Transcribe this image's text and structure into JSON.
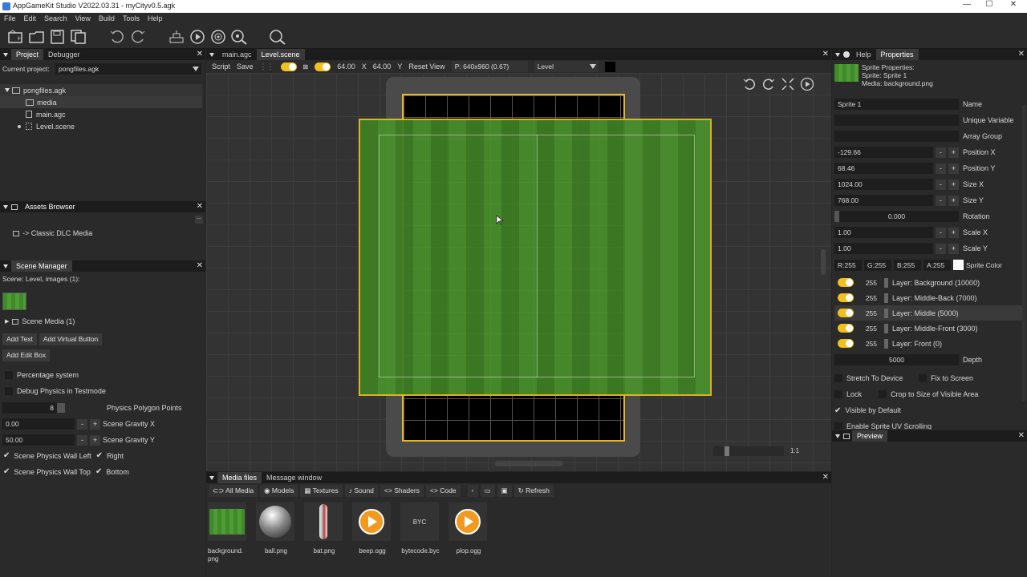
{
  "window": {
    "title": "AppGameKit Studio V2022.03.31 - myCityv0.5.agk",
    "min": "—",
    "max": "☐",
    "close": "✕"
  },
  "menu": [
    "File",
    "Edit",
    "Search",
    "View",
    "Build",
    "Tools",
    "Help"
  ],
  "project": {
    "tabs": [
      "Project",
      "Debugger"
    ],
    "current_label": "Current project:",
    "current_value": "pongfiles.agk",
    "tree": [
      {
        "name": "pongfiles.agk",
        "depth": 0,
        "icon": "folder-icon"
      },
      {
        "name": "media",
        "depth": 1,
        "icon": "folder-icon"
      },
      {
        "name": "main.agc",
        "depth": 1,
        "icon": "file-icon"
      },
      {
        "name": "Level.scene",
        "depth": 1,
        "icon": "scene-icon"
      }
    ]
  },
  "assets": {
    "title": "Assets Browser",
    "dots": "...",
    "item": "-> Classic DLC Media"
  },
  "scene_manager": {
    "title": "Scene Manager",
    "scene_label": "Scene: Level, images (1):",
    "scene_media": "Scene Media (1)",
    "add_text": "Add Text",
    "add_virtual_button": "Add Virtual Button",
    "add_edit_box": "Add Edit Box",
    "percentage": "Percentage system",
    "debug_physics": "Debug Physics in Testmode",
    "polygon_value": "8",
    "polygon_label": "Physics Polygon Points",
    "gravity_x_value": "0.00",
    "gravity_x_label": "Scene Gravity X",
    "gravity_y_value": "50.00",
    "gravity_y_label": "Scene Gravity Y",
    "minus": "-",
    "plus": "+",
    "wall_left": "Scene Physics Wall Left",
    "wall_right": "Right",
    "wall_top": "Scene Physics Wall Top",
    "wall_bottom": "Bottom"
  },
  "editor": {
    "tabs": [
      "main.agc",
      "Level.scene"
    ],
    "script": "Script",
    "save": "Save",
    "grid_x": "64.00",
    "x_label": "X",
    "grid_y": "64.00",
    "y_label": "Y",
    "reset_view": "Reset View",
    "resolution": "P: 640x960 (0.67)",
    "layer": "Level",
    "zoom": "1:1"
  },
  "media": {
    "tabs": [
      "Media files",
      "Message window"
    ],
    "filters": [
      "All Media",
      "Models",
      "Textures",
      "Sound",
      "Shaders",
      "Code"
    ],
    "refresh": "Refresh",
    "files": [
      {
        "name": "background.\npng",
        "kind": "grass"
      },
      {
        "name": "ball.png",
        "kind": "ball"
      },
      {
        "name": "bat.png",
        "kind": "bat"
      },
      {
        "name": "beep.ogg",
        "kind": "audio"
      },
      {
        "name": "bytecode.byc",
        "kind": "byc",
        "thumb": "BYC"
      },
      {
        "name": "plop.ogg",
        "kind": "audio"
      }
    ]
  },
  "properties": {
    "tabs": [
      "Help",
      "Properties"
    ],
    "header": [
      "Sprite Properties:",
      "Sprite: Sprite 1",
      "Media: background.png"
    ],
    "name_value": "Sprite 1",
    "name_label": "Name",
    "unique_label": "Unique Variable",
    "array_label": "Array Group",
    "pos_x": "-129.66",
    "pos_x_label": "Position X",
    "pos_y": "68.46",
    "pos_y_label": "Position Y",
    "size_x": "1024.00",
    "size_x_label": "Size X",
    "size_y": "768.00",
    "size_y_label": "Size Y",
    "rotation": "0.000",
    "rotation_label": "Rotation",
    "scale_x": "1.00",
    "scale_x_label": "Scale X",
    "scale_y": "1.00",
    "scale_y_label": "Scale Y",
    "r": "R:255",
    "g": "G:255",
    "b": "B:255",
    "a": "A:255",
    "color_label": "Sprite Color",
    "layers": [
      {
        "value": "255",
        "name": "Layer: Background (10000)"
      },
      {
        "value": "255",
        "name": "Layer: Middle-Back (7000)"
      },
      {
        "value": "255",
        "name": "Layer: Middle (5000)"
      },
      {
        "value": "255",
        "name": "Layer: Middle-Front (3000)"
      },
      {
        "value": "255",
        "name": "Layer: Front (0)"
      }
    ],
    "depth": "5000",
    "depth_label": "Depth",
    "stretch": "Stretch To Device",
    "fix": "Fix to Screen",
    "lock": "Lock",
    "crop": "Crop to Size of Visible Area",
    "visible": "Visible by Default",
    "uv": "Enable Sprite UV Scrolling"
  },
  "preview": {
    "title": "Preview"
  }
}
